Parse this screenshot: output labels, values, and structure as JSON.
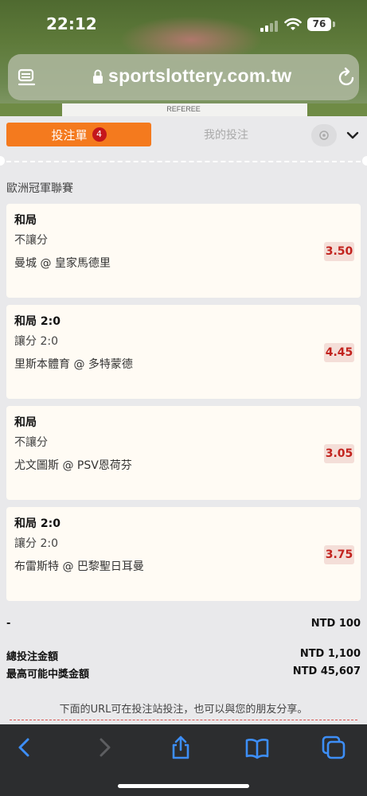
{
  "status_bar": {
    "time": "22:12",
    "battery": "76"
  },
  "browser": {
    "url": "sportslottery.com.tw",
    "referee_text": "REFEREE"
  },
  "tabs": {
    "bet_slip_label": "投注單",
    "bet_slip_count": "4",
    "my_bets_label": "我的投注"
  },
  "league": "歐洲冠軍聯賽",
  "bets": [
    {
      "market": "和局",
      "handicap": "不讓分",
      "match": "曼城 @ 皇家馬德里",
      "odds": "3.50"
    },
    {
      "market": "和局 2:0",
      "handicap": "讓分 2:0",
      "match": "里斯本體育 @ 多特蒙德",
      "odds": "4.45"
    },
    {
      "market": "和局",
      "handicap": "不讓分",
      "match": "尤文圖斯 @ PSV恩荷芬",
      "odds": "3.05"
    },
    {
      "market": "和局 2:0",
      "handicap": "讓分 2:0",
      "match": "布雷斯特 @ 巴黎聖日耳曼",
      "odds": "3.75"
    }
  ],
  "summary": {
    "stake_label": "-",
    "stake_value": "NTD 100",
    "total_label": "總投注金額",
    "total_value": "NTD 1,100",
    "max_win_label": "最高可能中獎金額",
    "max_win_value": "NTD 45,607"
  },
  "share_note": "下面的URL可在投注站投注，也可以與您的朋友分享。",
  "colors": {
    "accent": "#f47a1e",
    "badge": "#c4161c",
    "odds_text": "#c2231e",
    "toolbar_icon": "#3d8ef7"
  }
}
